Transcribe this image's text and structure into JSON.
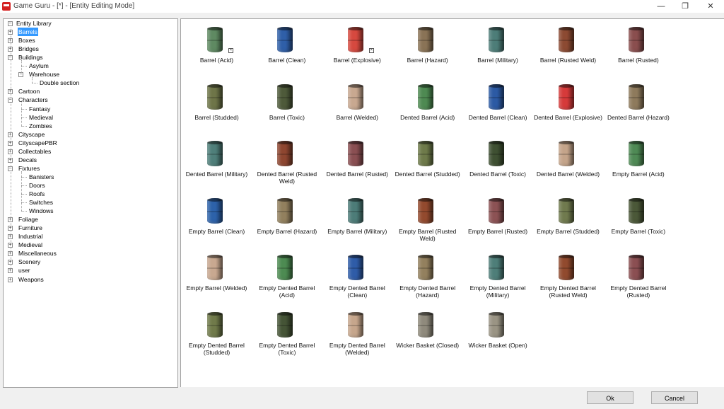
{
  "window": {
    "title": "Game Guru - [*] - [Entity Editing Mode]",
    "minimize": "—",
    "maximize": "❐",
    "close": "✕"
  },
  "tree": {
    "root": "Entity Library",
    "items": [
      {
        "label": "Barrels",
        "level": 1,
        "expander": "+",
        "selected": true
      },
      {
        "label": "Boxes",
        "level": 1,
        "expander": "+"
      },
      {
        "label": "Bridges",
        "level": 1,
        "expander": "+"
      },
      {
        "label": "Buildings",
        "level": 1,
        "expander": "-"
      },
      {
        "label": "Asylum",
        "level": 2
      },
      {
        "label": "Warehouse",
        "level": 2,
        "expander": "-"
      },
      {
        "label": "Double section",
        "level": 3
      },
      {
        "label": "Cartoon",
        "level": 1,
        "expander": "+"
      },
      {
        "label": "Characters",
        "level": 1,
        "expander": "-"
      },
      {
        "label": "Fantasy",
        "level": 2
      },
      {
        "label": "Medieval",
        "level": 2
      },
      {
        "label": "Zombies",
        "level": 2
      },
      {
        "label": "Cityscape",
        "level": 1,
        "expander": "+"
      },
      {
        "label": "CityscapePBR",
        "level": 1,
        "expander": "+"
      },
      {
        "label": "Collectables",
        "level": 1,
        "expander": "+"
      },
      {
        "label": "Decals",
        "level": 1,
        "expander": "+"
      },
      {
        "label": "Fixtures",
        "level": 1,
        "expander": "-"
      },
      {
        "label": "Banisters",
        "level": 2
      },
      {
        "label": "Doors",
        "level": 2
      },
      {
        "label": "Roofs",
        "level": 2
      },
      {
        "label": "Switches",
        "level": 2
      },
      {
        "label": "Windows",
        "level": 2
      },
      {
        "label": "Foliage",
        "level": 1,
        "expander": "+"
      },
      {
        "label": "Furniture",
        "level": 1,
        "expander": "+"
      },
      {
        "label": "Industrial",
        "level": 1,
        "expander": "+"
      },
      {
        "label": "Medieval",
        "level": 1,
        "expander": "+"
      },
      {
        "label": "Miscellaneous",
        "level": 1,
        "expander": "+"
      },
      {
        "label": "Scenery",
        "level": 1,
        "expander": "+"
      },
      {
        "label": "user",
        "level": 1,
        "expander": "+"
      },
      {
        "label": "Weapons",
        "level": 1,
        "expander": "+"
      }
    ]
  },
  "entities": [
    {
      "label": "Barrel (Acid)",
      "color": "#5f8a62",
      "flag": true
    },
    {
      "label": "Barrel (Clean)",
      "color": "#2f5fa8"
    },
    {
      "label": "Barrel (Explosive)",
      "color": "#d6493f",
      "flag": true
    },
    {
      "label": "Barrel (Hazard)",
      "color": "#8a7356"
    },
    {
      "label": "Barrel (Military)",
      "color": "#4d7d78"
    },
    {
      "label": "Barrel (Rusted Weld)",
      "color": "#8c4a32"
    },
    {
      "label": "Barrel (Rusted)",
      "color": "#8a4e4e"
    },
    {
      "label": "Barrel (Studded)",
      "color": "#6e7548"
    },
    {
      "label": "Barrel (Toxic)",
      "color": "#4e5a3a"
    },
    {
      "label": "Barrel (Welded)",
      "color": "#c8a890"
    },
    {
      "label": "Dented Barrel (Acid)",
      "color": "#4e8a52"
    },
    {
      "label": "Dented Barrel (Clean)",
      "color": "#2c5aa4"
    },
    {
      "label": "Dented Barrel (Explosive)",
      "color": "#d63a3a"
    },
    {
      "label": "Dented Barrel (Hazard)",
      "color": "#8e7a5c"
    },
    {
      "label": "Dented Barrel (Military)",
      "color": "#4f7f7a"
    },
    {
      "label": "Dented Barrel (Rusted Weld)",
      "color": "#8e4630"
    },
    {
      "label": "Dented Barrel (Rusted)",
      "color": "#8a4f52"
    },
    {
      "label": "Dented Barrel (Studded)",
      "color": "#6e7a4a"
    },
    {
      "label": "Dented Barrel (Toxic)",
      "color": "#3f5032"
    },
    {
      "label": "Dented Barrel (Welded)",
      "color": "#c4a48a"
    },
    {
      "label": "Empty Barrel (Acid)",
      "color": "#4f8a55"
    },
    {
      "label": "Empty Barrel (Clean)",
      "color": "#2d62aa"
    },
    {
      "label": "Empty Barrel (Hazard)",
      "color": "#92805e"
    },
    {
      "label": "Empty Barrel (Military)",
      "color": "#4d7c78"
    },
    {
      "label": "Empty Barrel (Rusted Weld)",
      "color": "#934a2e"
    },
    {
      "label": "Empty Barrel (Rusted)",
      "color": "#8c5254"
    },
    {
      "label": "Empty Barrel (Studded)",
      "color": "#707a4e"
    },
    {
      "label": "Empty Barrel (Toxic)",
      "color": "#4b5838"
    },
    {
      "label": "Empty Barrel (Welded)",
      "color": "#c8a890"
    },
    {
      "label": "Empty Dented Barrel (Acid)",
      "color": "#4d8b52"
    },
    {
      "label": "Empty Dented Barrel (Clean)",
      "color": "#2f5ca8"
    },
    {
      "label": "Empty Dented Barrel (Hazard)",
      "color": "#93805e"
    },
    {
      "label": "Empty Dented Barrel (Military)",
      "color": "#4e7e79"
    },
    {
      "label": "Empty Dented Barrel (Rusted Weld)",
      "color": "#914a2e"
    },
    {
      "label": "Empty Dented Barrel (Rusted)",
      "color": "#8b4f52"
    },
    {
      "label": "Empty Dented Barrel (Studded)",
      "color": "#707a4a"
    },
    {
      "label": "Empty Dented Barrel (Toxic)",
      "color": "#455436"
    },
    {
      "label": "Empty Dented Barrel (Welded)",
      "color": "#c6a68c"
    },
    {
      "label": "Wicker Basket (Closed)",
      "color": "#8f8a7c"
    },
    {
      "label": "Wicker Basket (Open)",
      "color": "#9a9484"
    }
  ],
  "buttons": {
    "ok": "Ok",
    "cancel": "Cancel"
  }
}
